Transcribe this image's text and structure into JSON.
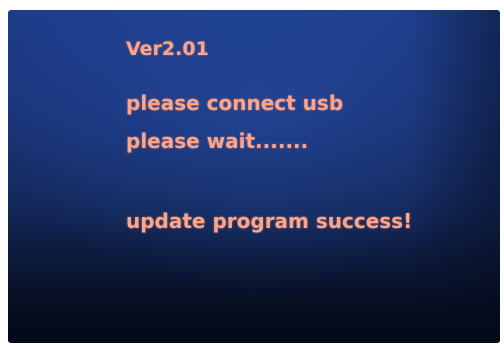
{
  "screen": {
    "version": "Ver2.01",
    "messages": [
      "please connect usb",
      "please wait.......",
      "update program success!"
    ],
    "text_color": "#ffa487",
    "background_color": "#1a3477"
  }
}
